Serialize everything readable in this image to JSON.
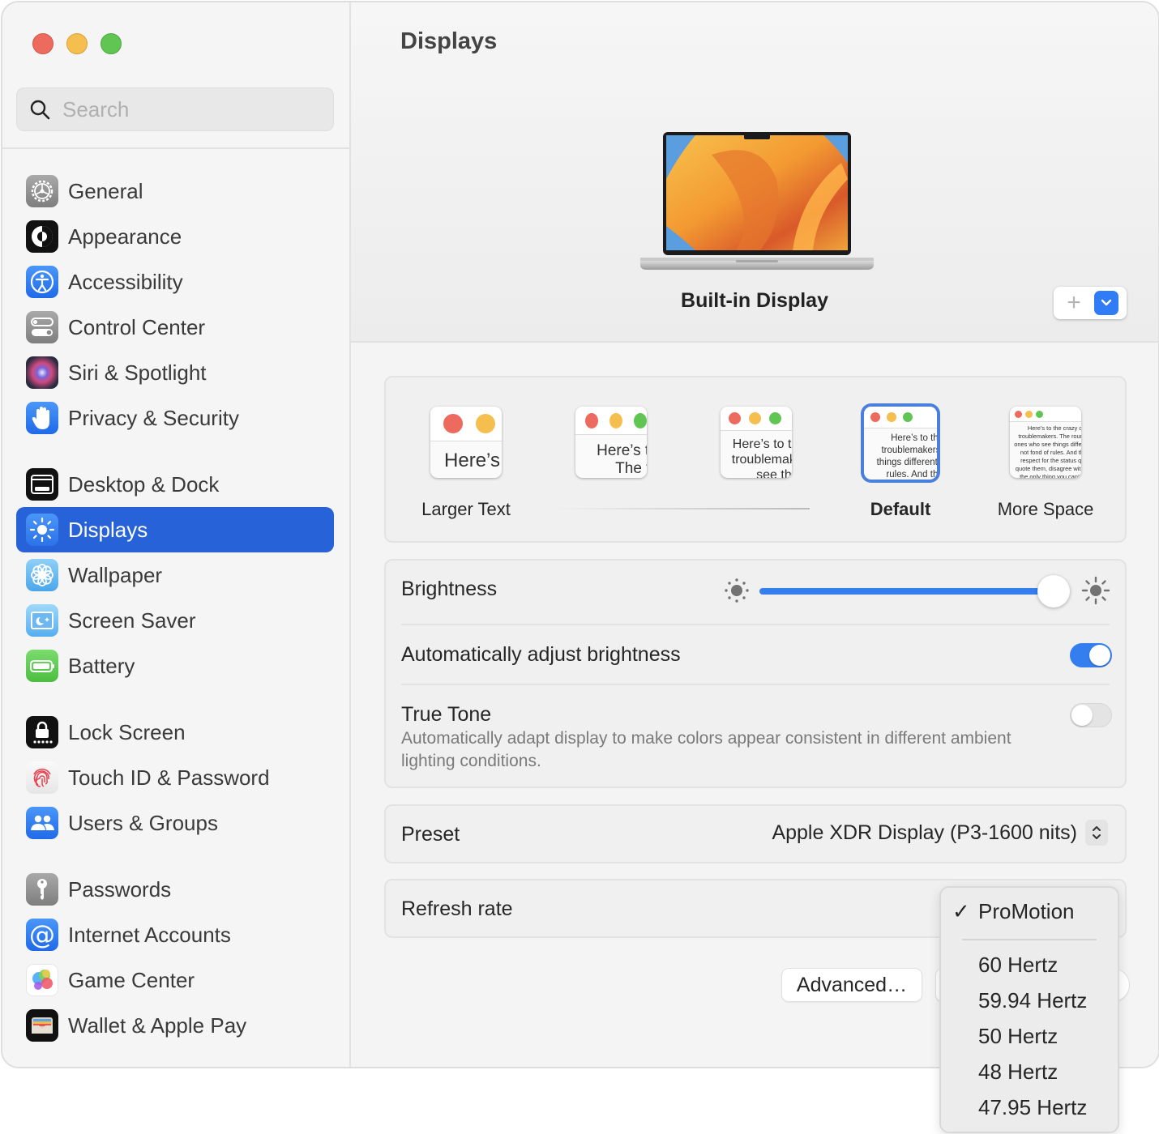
{
  "window": {
    "traffic_lights": [
      "close",
      "minimize",
      "zoom"
    ]
  },
  "search": {
    "placeholder": "Search",
    "value": "",
    "icon": "magnifying-glass-icon"
  },
  "sidebar": {
    "items": [
      {
        "label": "General",
        "icon": "gear-icon",
        "active": false
      },
      {
        "label": "Appearance",
        "icon": "appearance-icon",
        "active": false
      },
      {
        "label": "Accessibility",
        "icon": "accessibility-icon",
        "active": false
      },
      {
        "label": "Control Center",
        "icon": "control-center-icon",
        "active": false
      },
      {
        "label": "Siri & Spotlight",
        "icon": "siri-icon",
        "active": false
      },
      {
        "label": "Privacy & Security",
        "icon": "hand-icon",
        "active": false
      },
      {
        "label": "Desktop & Dock",
        "icon": "dock-icon",
        "active": false
      },
      {
        "label": "Displays",
        "icon": "sun-icon",
        "active": true
      },
      {
        "label": "Wallpaper",
        "icon": "flower-icon",
        "active": false
      },
      {
        "label": "Screen Saver",
        "icon": "screen-saver-icon",
        "active": false
      },
      {
        "label": "Battery",
        "icon": "battery-icon",
        "active": false
      },
      {
        "label": "Lock Screen",
        "icon": "lock-icon",
        "active": false
      },
      {
        "label": "Touch ID & Password",
        "icon": "fingerprint-icon",
        "active": false
      },
      {
        "label": "Users & Groups",
        "icon": "users-icon",
        "active": false
      },
      {
        "label": "Passwords",
        "icon": "key-icon",
        "active": false
      },
      {
        "label": "Internet Accounts",
        "icon": "at-icon",
        "active": false
      },
      {
        "label": "Game Center",
        "icon": "game-center-icon",
        "active": false
      },
      {
        "label": "Wallet & Apple Pay",
        "icon": "wallet-icon",
        "active": false
      }
    ]
  },
  "main": {
    "title": "Displays",
    "display_name": "Built-in Display",
    "display_controls": {
      "add_label": "+",
      "menu_icon": "chevron-down-icon"
    },
    "resolution": {
      "options": [
        {
          "caption": "Larger Text",
          "preview": "Here’s",
          "selected": false
        },
        {
          "caption": "",
          "preview": "Here’s to the crazy ones. The troublemakers.",
          "selected": false
        },
        {
          "caption": "",
          "preview": "Here’s to the crazy ones. The troublemakers. The ones who see things differently.",
          "selected": false
        },
        {
          "caption": "Default",
          "preview": "Here’s to the crazy ones. The troublemakers. The ones who see things differently. They’re not fond of rules. And they have no respect",
          "selected": true
        },
        {
          "caption": "More Space",
          "preview": "Here’s to the crazy ones. The troublemakers. The round pegs. The ones who see things differently. They’re not fond of rules. And they have no respect for the status quo. You can quote them, disagree with them. About the only thing you can’t do is ignore them. Because they change things.",
          "selected": false
        }
      ]
    },
    "brightness": {
      "label": "Brightness",
      "value_fraction": 0.95
    },
    "auto_brightness": {
      "label": "Automatically adjust brightness",
      "enabled": true
    },
    "true_tone": {
      "label": "True Tone",
      "description": "Automatically adapt display to make colors appear consistent in different ambient lighting conditions.",
      "enabled": false
    },
    "preset": {
      "label": "Preset",
      "value": "Apple XDR Display (P3-1600 nits)"
    },
    "refresh_rate": {
      "label": "Refresh rate",
      "menu_open": true,
      "options": [
        {
          "label": "ProMotion",
          "checked": true
        },
        {
          "label": "60 Hertz",
          "checked": false
        },
        {
          "label": "59.94 Hertz",
          "checked": false
        },
        {
          "label": "50 Hertz",
          "checked": false
        },
        {
          "label": "48 Hertz",
          "checked": false
        },
        {
          "label": "47.95 Hertz",
          "checked": false
        }
      ],
      "check_glyph": "✓"
    },
    "buttons": {
      "advanced": "Advanced…"
    }
  },
  "colors": {
    "accent": "#2862d9",
    "slider_fill": "#357ef0",
    "toggle_on": "#357ef0"
  }
}
